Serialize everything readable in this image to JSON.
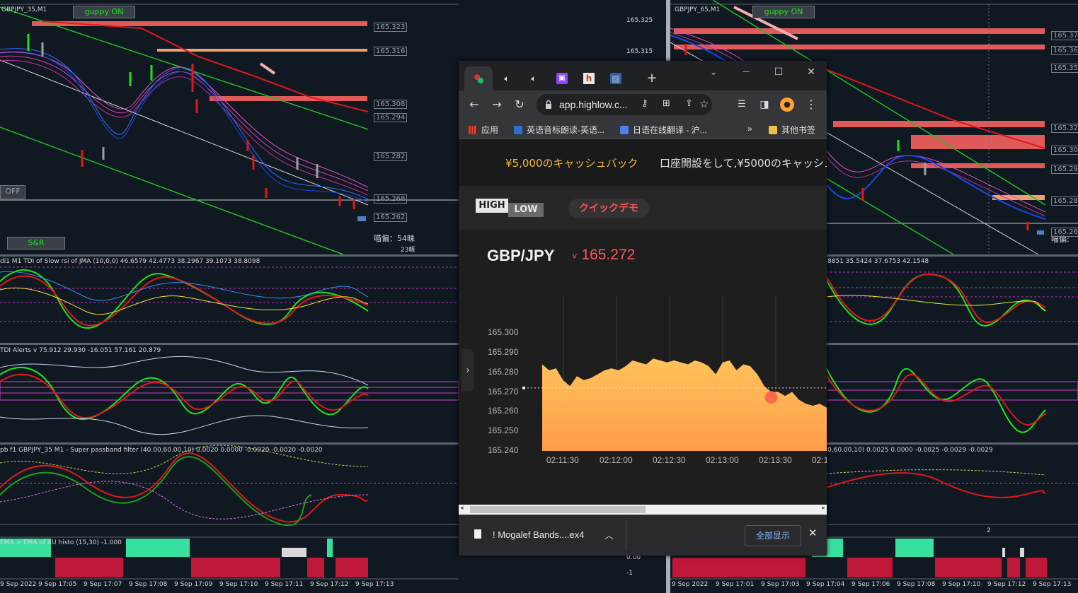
{
  "left_chart": {
    "title": "GBPJPY_35,M1",
    "guppy_button": "guppy ON",
    "off_button": "OFF",
    "sr_button": "S&R",
    "price_labels": [
      "165.325",
      "165.315"
    ],
    "price_tags": [
      "165.323",
      "165.316",
      "165.308",
      "165.294",
      "165.282",
      "165.268",
      "165.262"
    ],
    "spread_text": "喵偏：54昧",
    "sub_text": "23帳",
    "ind1_label": "di1 M1 TDI of Slow rsi of JMA (10,0,0) 46.6579 42.4773 38.2967 39.1073 38.8098",
    "ind2_label": "TDI Alerts v 75.912 29.930 -16.051 57.161 20.879",
    "ind3_label": "pb f1 GBPJPY_35 M1 - Super passband filter (40.00,60.00,10) 0.0020 0.0000 -0.0020 -0.0020 -0.0020",
    "ind4_label": "EMA > EMA of XU histo (15,30) -1.000",
    "ind4_levels": [
      "0.00",
      "-1"
    ],
    "time_labels": [
      "9 Sep 2022",
      "9 Sep 17:05",
      "9 Sep 17:07",
      "9 Sep 17:08",
      "9 Sep 17:09",
      "9 Sep 17:10",
      "9 Sep 17:11",
      "9 Sep 17:12",
      "9 Sep 17:13"
    ]
  },
  "right_chart": {
    "title": "GBPJPY_65,M1",
    "guppy_button": "guppy ON",
    "price_tags": [
      "165.37",
      "165.36",
      "165.35",
      "165.32",
      "165.30",
      "165.29",
      "165.28",
      "165.26"
    ],
    "spread_text": "喵偏:",
    "ind1_label": "8851 35.5424 37.6753 42.1548",
    "ind3_label": "0,60.00,10) 0.0025 0.0000 -0.0025 -0.0029 -0.0029",
    "page_number": "2",
    "time_labels": [
      "9 Sep 2022",
      "9 Sep 17:01",
      "9 Sep 17:03",
      "9 Sep 17:04",
      "9 Sep 17:06",
      "9 Sep 17:08",
      "9 Sep 17:10",
      "9 Sep 17:12",
      "9 Sep 17:13"
    ]
  },
  "browser": {
    "new_tab": "+",
    "minimize": "—",
    "maximize": "☐",
    "close": "✕",
    "url": "app.highlow.c...",
    "bookmarks": [
      "应用",
      "英语音标朗读-英语...",
      "日语在线翻译 - 沪...",
      "»",
      "其他书签"
    ],
    "promo_cashback": "¥5,000のキャッシュバック",
    "promo_account": "口座開設をして,¥5000のキャッシュ",
    "logo_high": "HIGH",
    "logo_low": "LOW",
    "quick_demo": "クイックデモ",
    "pair": "GBP/JPY",
    "price_arrow": "˅",
    "price": "165.272",
    "download_file": "! Mogalef Bands....ex4",
    "show_all": "全部显示",
    "download_close": "✕"
  },
  "chart_data": {
    "type": "area",
    "title": "GBP/JPY",
    "y_ticks": [
      "165.300",
      "165.290",
      "165.280",
      "165.270",
      "165.260",
      "165.250",
      "165.240"
    ],
    "x_ticks": [
      "02:11:30",
      "02:12:00",
      "02:12:30",
      "02:13:00",
      "02:13:30",
      "02:1"
    ],
    "ylim": [
      165.24,
      165.3
    ],
    "current_price": 165.272,
    "series": [
      {
        "values": [
          165.284,
          165.281,
          165.282,
          165.276,
          165.273,
          165.278,
          165.276,
          165.277,
          165.279,
          165.281,
          165.282,
          165.281,
          165.283,
          165.286,
          165.285,
          165.284,
          165.287,
          165.286,
          165.285,
          165.286,
          165.285,
          165.284,
          165.286,
          165.285,
          165.283,
          165.279,
          165.285,
          165.286,
          165.281,
          165.284,
          165.283,
          165.279,
          165.273,
          165.27,
          165.27,
          165.268,
          165.27,
          165.266,
          165.264,
          165.263,
          165.264,
          165.262
        ]
      }
    ]
  },
  "colors": {
    "accent_red": "#ff5252",
    "guppy_green": "#19e619",
    "area_top": "#ffc25a",
    "area_bottom": "#ff9d4a"
  }
}
